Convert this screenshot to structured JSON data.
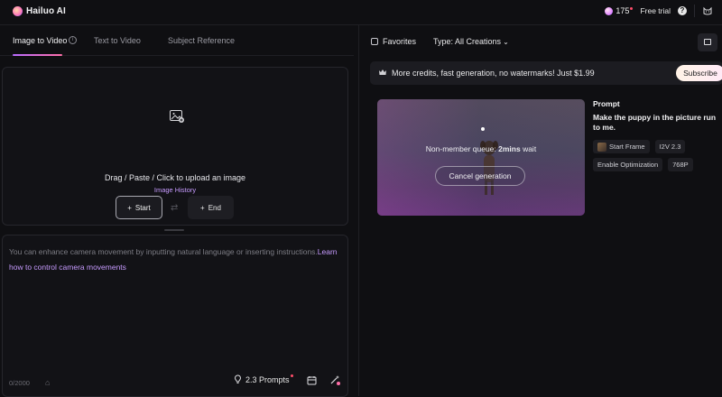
{
  "app": {
    "name": "Hailuo AI"
  },
  "header": {
    "credits": "175",
    "free_trial": "Free trial",
    "help": "?"
  },
  "tabs": [
    {
      "label": "Image to Video"
    },
    {
      "label": "Text to Video"
    },
    {
      "label": "Subject Reference"
    }
  ],
  "upload": {
    "instruction": "Drag / Paste / Click to upload an image",
    "history": "Image History",
    "start_label": "Start",
    "end_label": "End"
  },
  "prompt": {
    "placeholder_text": "You can enhance camera movement by inputting natural language or inserting instructions.",
    "placeholder_link": "Learn how to control camera movements",
    "char_count": "0/2000",
    "prompts_label": "2.3 Prompts"
  },
  "filters": {
    "favorites": "Favorites",
    "type_label": "Type:",
    "type_value": "All Creations"
  },
  "promo": {
    "text": "More credits, fast generation, no watermarks! Just $1.99",
    "button": "Subscribe"
  },
  "generation": {
    "queue_prefix": "Non-member queue: ",
    "queue_wait": "2mins",
    "queue_suffix": " wait",
    "cancel": "Cancel generation",
    "prompt_title": "Prompt",
    "prompt_text": "Make the puppy in the picture run to me.",
    "chips": [
      "Start Frame",
      "I2V 2.3",
      "Enable Optimization",
      "768P"
    ]
  },
  "colors": {
    "accent": "#c79bff",
    "background": "#0f0f12",
    "panel": "#121216"
  }
}
